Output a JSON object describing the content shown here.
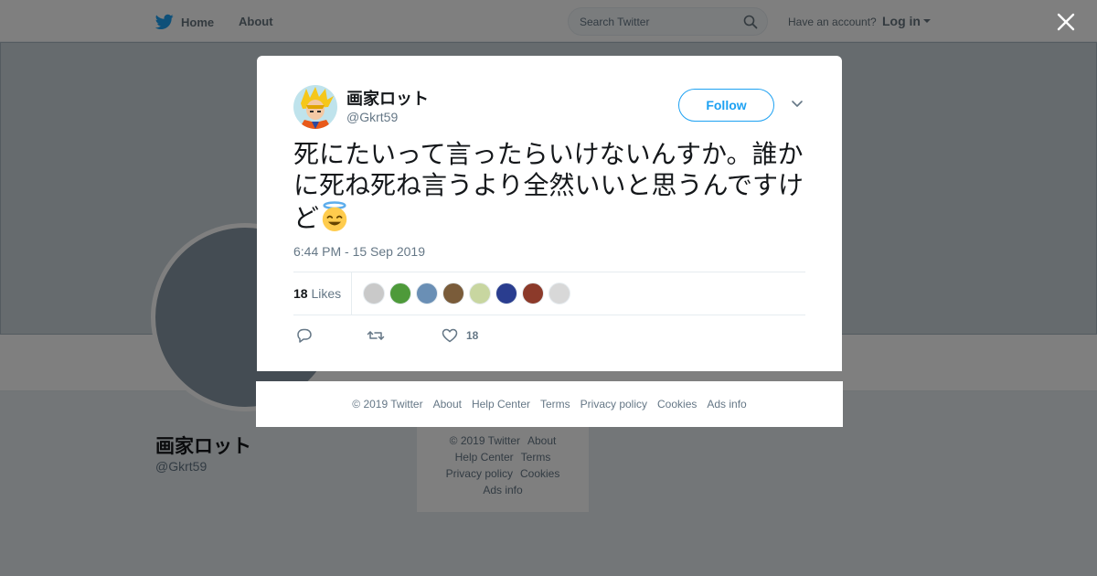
{
  "topbar": {
    "home_label": "Home",
    "about_label": "About",
    "search_placeholder": "Search Twitter",
    "have_account": "Have an account?",
    "login_label": "Log in"
  },
  "profile": {
    "name": "画家ロット",
    "handle": "@Gkrt59"
  },
  "background_footer": {
    "line1": [
      "© 2019 Twitter",
      "About"
    ],
    "line2": [
      "Help Center",
      "Terms"
    ],
    "line3": [
      "Privacy policy",
      "Cookies"
    ],
    "line4": [
      "Ads info"
    ]
  },
  "tweet": {
    "author_name": "画家ロット",
    "author_handle": "@Gkrt59",
    "follow_label": "Follow",
    "text": "死にたいって言ったらいけないんすか。誰かに死ね死ね言うより全然いいと思うんですけど",
    "emoji": "smiling-face-with-halo",
    "timestamp": "6:44 PM - 15 Sep 2019",
    "likes_count": "18",
    "likes_label": "Likes",
    "like_action_count": "18",
    "liker_colors": [
      "#c9c9c9",
      "#4e9a3a",
      "#6a8fb5",
      "#7a5c3a",
      "#c8d6a0",
      "#2a3d8f",
      "#8c3a2a",
      "#d8d8d8"
    ]
  },
  "modal_footer": {
    "items": [
      "© 2019 Twitter",
      "About",
      "Help Center",
      "Terms",
      "Privacy policy",
      "Cookies",
      "Ads info"
    ]
  },
  "colors": {
    "accent": "#1da1f2",
    "muted": "#657786"
  }
}
